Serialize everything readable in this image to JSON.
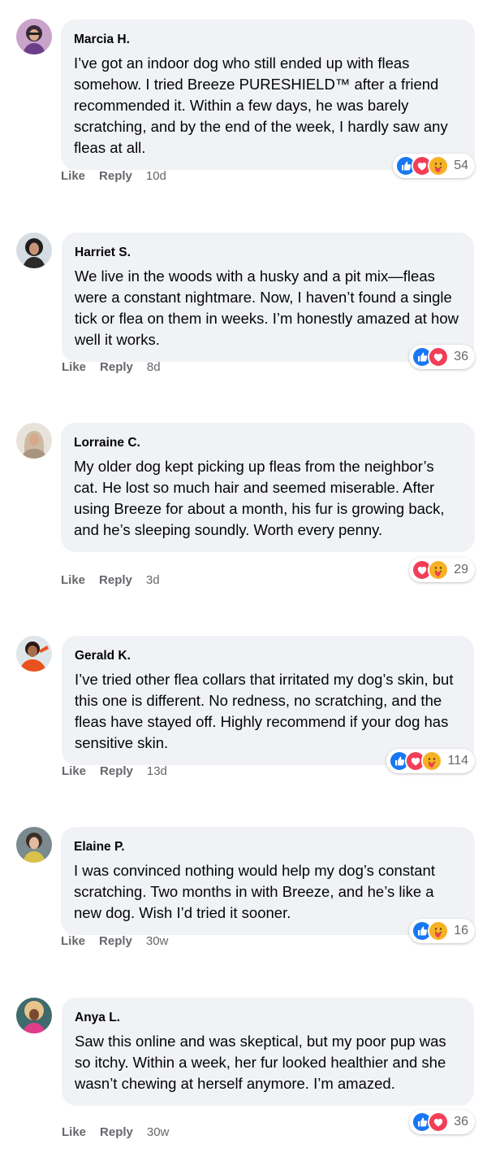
{
  "colors": {
    "bubble": "#f0f2f5",
    "meta_text": "#65676b",
    "like_blue": "#1877f2",
    "love_red": "#f33e58",
    "care_yellow": "#f7b125"
  },
  "actions": {
    "like_label": "Like",
    "reply_label": "Reply"
  },
  "comments": [
    {
      "author": "Marcia H.",
      "text": "I’ve got an indoor dog who still ended up with fleas somehow. I tried Breeze PURESHIELD™ after a friend recommended it. Within a few days, he was barely scratching, and by the end of the week, I hardly saw any fleas at all.",
      "time": "10d",
      "reaction_count": "54",
      "reactions": [
        "like-icon",
        "love-icon",
        "care-icon"
      ]
    },
    {
      "author": "Harriet S.",
      "text": "We live in the woods with a husky and a pit mix—fleas were a constant nightmare. Now, I haven’t found a single tick or flea on them in weeks. I’m honestly amazed at how well it works.",
      "time": "8d",
      "reaction_count": "36",
      "reactions": [
        "like-icon",
        "love-icon"
      ]
    },
    {
      "author": "Lorraine C.",
      "text": "My older dog kept picking up fleas from the neighbor’s cat. He lost so much hair and seemed miserable. After using Breeze for about a month, his fur is growing back, and he’s sleeping soundly. Worth every penny.",
      "time": "3d",
      "reaction_count": "29",
      "reactions": [
        "love-icon",
        "care-icon"
      ]
    },
    {
      "author": "Gerald K.",
      "text": "I’ve tried other flea collars that irritated my dog’s skin, but this one is different. No redness, no scratching, and the fleas have stayed off. Highly recommend if your dog has sensitive skin.",
      "time": "13d",
      "reaction_count": "114",
      "reactions": [
        "like-icon",
        "love-icon",
        "care-icon"
      ]
    },
    {
      "author": "Elaine P.",
      "text": "I was convinced nothing would help my dog’s constant scratching. Two months in with Breeze, and he’s like a new dog. Wish I’d tried it sooner.",
      "time": "30w",
      "reaction_count": "16",
      "reactions": [
        "like-icon",
        "care-icon"
      ]
    },
    {
      "author": "Anya L.",
      "text": "Saw this online and was skeptical, but my poor pup was so itchy. Within a week, her fur looked healthier and she wasn’t chewing at herself anymore. I’m amazed.",
      "time": "30w",
      "reaction_count": "36",
      "reactions": [
        "like-icon",
        "love-icon"
      ]
    }
  ]
}
